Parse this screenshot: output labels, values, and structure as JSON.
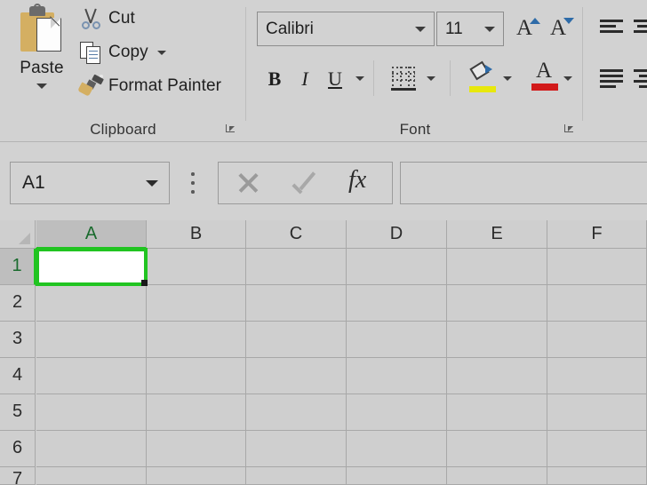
{
  "ribbon": {
    "clipboard": {
      "group_label": "Clipboard",
      "paste": {
        "label": "Paste",
        "icon": "clipboard-paste-icon"
      },
      "cut": {
        "label": "Cut",
        "icon": "scissors-icon"
      },
      "copy": {
        "label": "Copy",
        "icon": "copy-documents-icon"
      },
      "format_painter": {
        "label": "Format Painter",
        "icon": "paintbrush-icon"
      },
      "launcher": "dialog-launcher-icon"
    },
    "font": {
      "group_label": "Font",
      "font_name": "Calibri",
      "font_size": "11",
      "increase_font_size": "A",
      "decrease_font_size": "A",
      "bold": "B",
      "italic": "I",
      "underline": "U",
      "borders_icon": "bottom-border-icon",
      "fill_color_icon": "fill-color-icon",
      "font_color_icon": "font-color-icon",
      "launcher": "dialog-launcher-icon"
    },
    "alignment": {
      "align_left": "align-left-icon",
      "align_center": "align-center-icon",
      "align_justify": "align-justify-icon",
      "align_right": "align-right-icon"
    }
  },
  "formula_bar": {
    "name_box_value": "A1",
    "name_box_caret": "chevron-down-icon",
    "options_ellipsis": "vertical-ellipsis-icon",
    "cancel_icon": "cancel-x-icon",
    "enter_icon": "enter-check-icon",
    "insert_function_icon": "fx-icon",
    "insert_function_label": "fx",
    "formula_value": ""
  },
  "grid": {
    "columns": [
      "A",
      "B",
      "C",
      "D",
      "E",
      "F"
    ],
    "rows": [
      "1",
      "2",
      "3",
      "4",
      "5",
      "6",
      "7"
    ],
    "active_cell": "A1",
    "active_column": "A",
    "active_row": "1",
    "cell_contents": {},
    "selection_color": "#21c421",
    "select_all_icon": "select-all-corner-icon"
  },
  "colors": {
    "ribbon_background": "#d2d2d2",
    "grid_background": "#cfcfcf",
    "gridline": "#a8a8a8",
    "selection_green": "#21c421",
    "paste_gold": "#d4af62",
    "fill_yellow": "#e8e80c",
    "font_red": "#d21a1a",
    "accent_blue": "#2e6ba8"
  }
}
